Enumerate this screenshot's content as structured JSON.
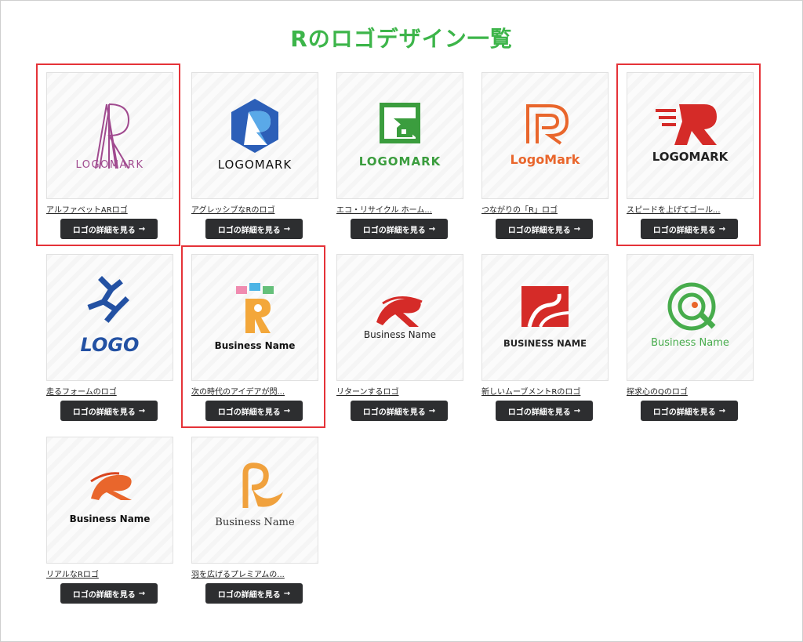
{
  "page": {
    "title": "Rのロゴデザイン一覧"
  },
  "button_label": "ロゴの詳細を見る",
  "button_arrow": "→",
  "colors": {
    "title": "#3db54a",
    "button": "#2d2e30",
    "highlight": "#e53238"
  },
  "logos": [
    {
      "caption": "アルファベットARロゴ",
      "logo_text": "LOGOMARK",
      "icon": "ar-letters-icon",
      "highlighted": true
    },
    {
      "caption": "アグレッシブなRのロゴ",
      "logo_text": "LOGOMARK",
      "icon": "hexagon-r-icon",
      "highlighted": false
    },
    {
      "caption": "エコ・リサイクル ホーム...",
      "logo_text": "LOGOMARK",
      "icon": "eco-house-icon",
      "highlighted": false
    },
    {
      "caption": "つながりの「R」ロゴ",
      "logo_text": "LogoMark",
      "icon": "connected-r-icon",
      "highlighted": false
    },
    {
      "caption": "スピードを上げてゴール...",
      "logo_text": "LOGOMARK",
      "icon": "speed-r-icon",
      "highlighted": true
    },
    {
      "caption": "走るフォームのロゴ",
      "logo_text": "LOGO",
      "icon": "running-figure-icon",
      "highlighted": false
    },
    {
      "caption": "次の時代のアイデアが閃...",
      "logo_text": "Business Name",
      "icon": "idea-r-icon",
      "highlighted": true
    },
    {
      "caption": "リターンするロゴ",
      "logo_text": "Business Name",
      "icon": "return-r-icon",
      "highlighted": false
    },
    {
      "caption": "新しいムーブメントRのロゴ",
      "logo_text": "BUSINESS NAME",
      "icon": "square-r-icon",
      "highlighted": false
    },
    {
      "caption": "探求心のQのロゴ",
      "logo_text": "Business Name",
      "icon": "search-q-icon",
      "highlighted": false
    },
    {
      "caption": "リアルなRロゴ",
      "logo_text": "Business Name",
      "icon": "real-r-icon",
      "highlighted": false
    },
    {
      "caption": "羽を広げるプレミアムの...",
      "logo_text": "Business Name",
      "icon": "premium-r-icon",
      "highlighted": false
    }
  ]
}
